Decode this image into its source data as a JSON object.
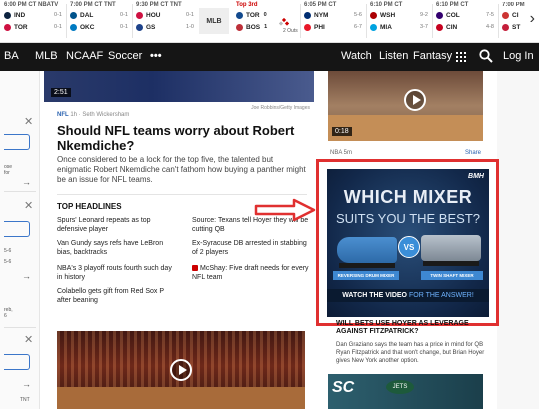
{
  "scoreboard": {
    "games": [
      {
        "status": "6:00 PM CT",
        "net": "NBATV",
        "t1": "IND",
        "s1": "0-1",
        "t2": "TOR",
        "s2": "0-1",
        "c1": "#0c2340",
        "c2": "#ce1141"
      },
      {
        "status": "7:00 PM CT",
        "net": "TNT",
        "t1": "DAL",
        "s1": "0-1",
        "t2": "OKC",
        "s2": "0-1",
        "c1": "#00538c",
        "c2": "#007ac1"
      },
      {
        "status": "9:30 PM CT",
        "net": "TNT",
        "t1": "HOU",
        "s1": "0-1",
        "t2": "GS",
        "s2": "1-0",
        "c1": "#ce1141",
        "c2": "#1d428a"
      },
      {
        "status": "Top 3rd",
        "net": "",
        "t1": "TOR",
        "s1": "0",
        "t2": "BOS",
        "s2": "1",
        "c1": "#134a8e",
        "c2": "#bd3039",
        "live": true,
        "outs": "2 Outs"
      },
      {
        "status": "6:05 PM CT",
        "net": "",
        "t1": "NYM",
        "s1": "5-6",
        "t2": "PHI",
        "s2": "6-7",
        "c1": "#002d72",
        "c2": "#e81828"
      },
      {
        "status": "6:10 PM CT",
        "net": "",
        "t1": "WSH",
        "s1": "9-2",
        "t2": "MIA",
        "s2": "3-7",
        "c1": "#ab0003",
        "c2": "#00a3e0"
      },
      {
        "status": "6:10 PM CT",
        "net": "",
        "t1": "COL",
        "s1": "7-5",
        "t2": "CIN",
        "s2": "4-8",
        "c1": "#33006f",
        "c2": "#c6011f"
      },
      {
        "status": "7:00 PM",
        "net": "",
        "t1": "CI",
        "s1": "",
        "t2": "ST",
        "s2": "",
        "c1": "#cc3433",
        "c2": "#c41e3a"
      }
    ],
    "league_label": "MLB"
  },
  "nav": {
    "left_items": [
      "BA",
      "MLB",
      "NCAAF",
      "Soccer",
      "•••"
    ],
    "right_items": [
      "Watch",
      "Listen",
      "Fantasy"
    ],
    "login": "Log In"
  },
  "left_rail": {
    "snippet1": "ose\nfor",
    "snippet2": "5-6\n5-6",
    "snippet3": "reb,\n6",
    "snippet4": "TNT"
  },
  "main": {
    "video1_duration": "2:51",
    "photo_credit": "Joe Robbins/Getty Images",
    "league": "NFL",
    "meta": "1h · Seth Wickersham",
    "headline": "Should NFL teams worry about Robert Nkemdiche?",
    "summary": "Once considered to be a lock for the top five, the talented but enigmatic Robert Nkemdiche can't fathom how buying a panther might be an issue for NFL teams.",
    "top_headlines_title": "TOP HEADLINES",
    "top_headlines": [
      "Spurs' Leonard repeats as top defensive player",
      "Van Gundy says refs have LeBron bias, backtracks",
      "NBA's 3 playoff routs fourth such day in history",
      "Colabello gets gift from Red Sox P after beaning",
      "Source: Texans tell Hoyer they will be cutting QB",
      "Ex-Syracuse DB arrested in stabbing of 2 players",
      "McShay: Five draft needs for every NFL team"
    ]
  },
  "right": {
    "video_duration": "0:18",
    "video_source": "NBA 5m",
    "share": "Share",
    "ad": {
      "brand": "BMH",
      "line1": "WHICH MIXER",
      "line2": "SUITS YOU THE BEST?",
      "vs": "VS",
      "label_a": "REVERSING DRUM MIXER",
      "label_b": "TWIN SHAFT MIXER",
      "cta_a": "WATCH THE VIDEO",
      "cta_b": "FOR THE ANSWER!"
    },
    "headline2": "WILL BETS USE HOYER AS LEVERAGE AGAINST FITZPATRICK?",
    "summary2": "Dan Graziano says the team has a price in mind for QB Ryan Fitzpatrick and that won't change, but Brian Hoyer gives New York another option.",
    "video4_logo": "SC",
    "jets": "JETS"
  },
  "colors": {
    "accent": "#e03030",
    "link": "#2a62b0",
    "nav_bg": "#151515"
  }
}
